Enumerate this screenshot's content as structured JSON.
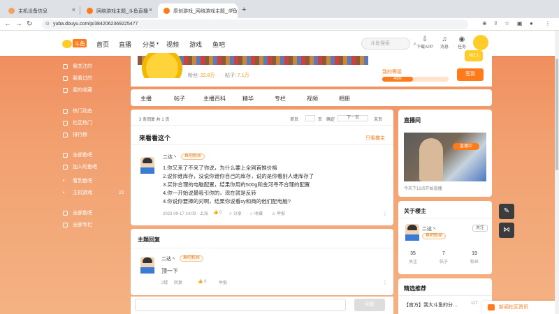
{
  "browser": {
    "tabs": [
      {
        "label": "主机设备信息",
        "favicon_color": "#f4a261",
        "active": false
      },
      {
        "label": "网络游戏主题_斗鱼直播",
        "favicon_color": "#ff7a1a",
        "active": false
      },
      {
        "label": "原创游戏_网络游戏主题_斗鱼直播",
        "favicon_color": "#ff7a1a",
        "active": true
      }
    ],
    "new_tab": "+",
    "url": "yuba.douyu.com/p/3842062369225477"
  },
  "header": {
    "logo_text": "斗鱼",
    "nav": [
      "首页",
      "直播",
      "分类",
      "视频",
      "游戏",
      "鱼吧"
    ],
    "search_placeholder": "斗鱼搜索",
    "icons": [
      {
        "label": "下载APP",
        "icon": "download-icon"
      },
      {
        "label": "消息",
        "icon": "bell-icon"
      },
      {
        "label": "鱼吧",
        "icon": "fish-icon"
      },
      {
        "label": "任务",
        "icon": "task-icon"
      }
    ]
  },
  "sidebar": {
    "items": [
      {
        "label": "我关注的",
        "count": ""
      },
      {
        "label": "我看过的",
        "count": ""
      },
      {
        "label": "我的收藏",
        "count": ""
      },
      {
        "label": "热门动态",
        "count": ""
      },
      {
        "label": "社区热门",
        "count": ""
      },
      {
        "label": "排行榜",
        "count": ""
      },
      {
        "label": "全部鱼吧",
        "count": ""
      },
      {
        "label": "加入的鱼吧",
        "count": ""
      },
      {
        "label": "看到鱼吧",
        "count": ""
      },
      {
        "label": "主机游戏",
        "count": "21"
      },
      {
        "label": "全部鱼吧",
        "count": ""
      },
      {
        "label": "全部专栏",
        "count": ""
      }
    ]
  },
  "banner": {
    "fans_label": "粉丝",
    "fans_value": "22.8万",
    "posts_label": "帖子",
    "posts_value": "7.1万",
    "level_label": "我的等级",
    "level_value": "4680",
    "sign_label": "签到",
    "rank_label": "NO.1"
  },
  "page_tabs": [
    "主播",
    "帖子",
    "主播百科",
    "精华",
    "专栏",
    "视频",
    "相册"
  ],
  "main_post": {
    "pagination": "3 条回复 共 1 页",
    "page_labels": [
      "首页",
      "下一页",
      "末页",
      "页",
      "确定"
    ],
    "title": "来看看这个",
    "only_host": "只看楼主",
    "user_name": "二达丶",
    "user_badge": "鱼吧粉丝",
    "lines": [
      "1.你又来了不来了你说，为什么要上全网首推价格",
      "2.说你谁库存，没说你谁你自己的库存，说的是你看别人谁库存了",
      "3.买你合理的电脑配置，结果你用的500g和金河寻不合理的配置",
      "4.你一开始说最吸引你的，现在就是反转",
      "4.你说你要捧的对啊，结果你说看sy和商的他们配电脑?"
    ],
    "meta": "2023-09-17 14:09 · 上海",
    "actions": [
      "0",
      "分享",
      "收藏",
      "举报"
    ]
  },
  "reply_section": {
    "title": "主题回复",
    "user_name": "二达丶",
    "user_badge": "鱼吧粉丝",
    "text": "顶一下",
    "meta": "2楼",
    "actions": [
      "回复",
      "0",
      "举报"
    ]
  },
  "reply_bar": {
    "placeholder": "",
    "send_label": "回复"
  },
  "live_card": {
    "title": "直播间",
    "caption": "今天下12点开始直播",
    "tag": "直播中"
  },
  "about_card": {
    "title": "关于楼主",
    "name": "二达丶",
    "follow_label": "关注",
    "stats": [
      {
        "value": "35",
        "label": "关注"
      },
      {
        "value": "7",
        "label": "帖子"
      },
      {
        "value": "19",
        "label": "粉丝"
      }
    ]
  },
  "rec_card": {
    "title": "精选推荐",
    "item": "【官方】我大斗鱼的分…",
    "count": "117"
  },
  "notification": {
    "text": "新闻社区资讯"
  },
  "colors": {
    "accent": "#ff7a1a",
    "gradient_top": "#f08a5a"
  }
}
